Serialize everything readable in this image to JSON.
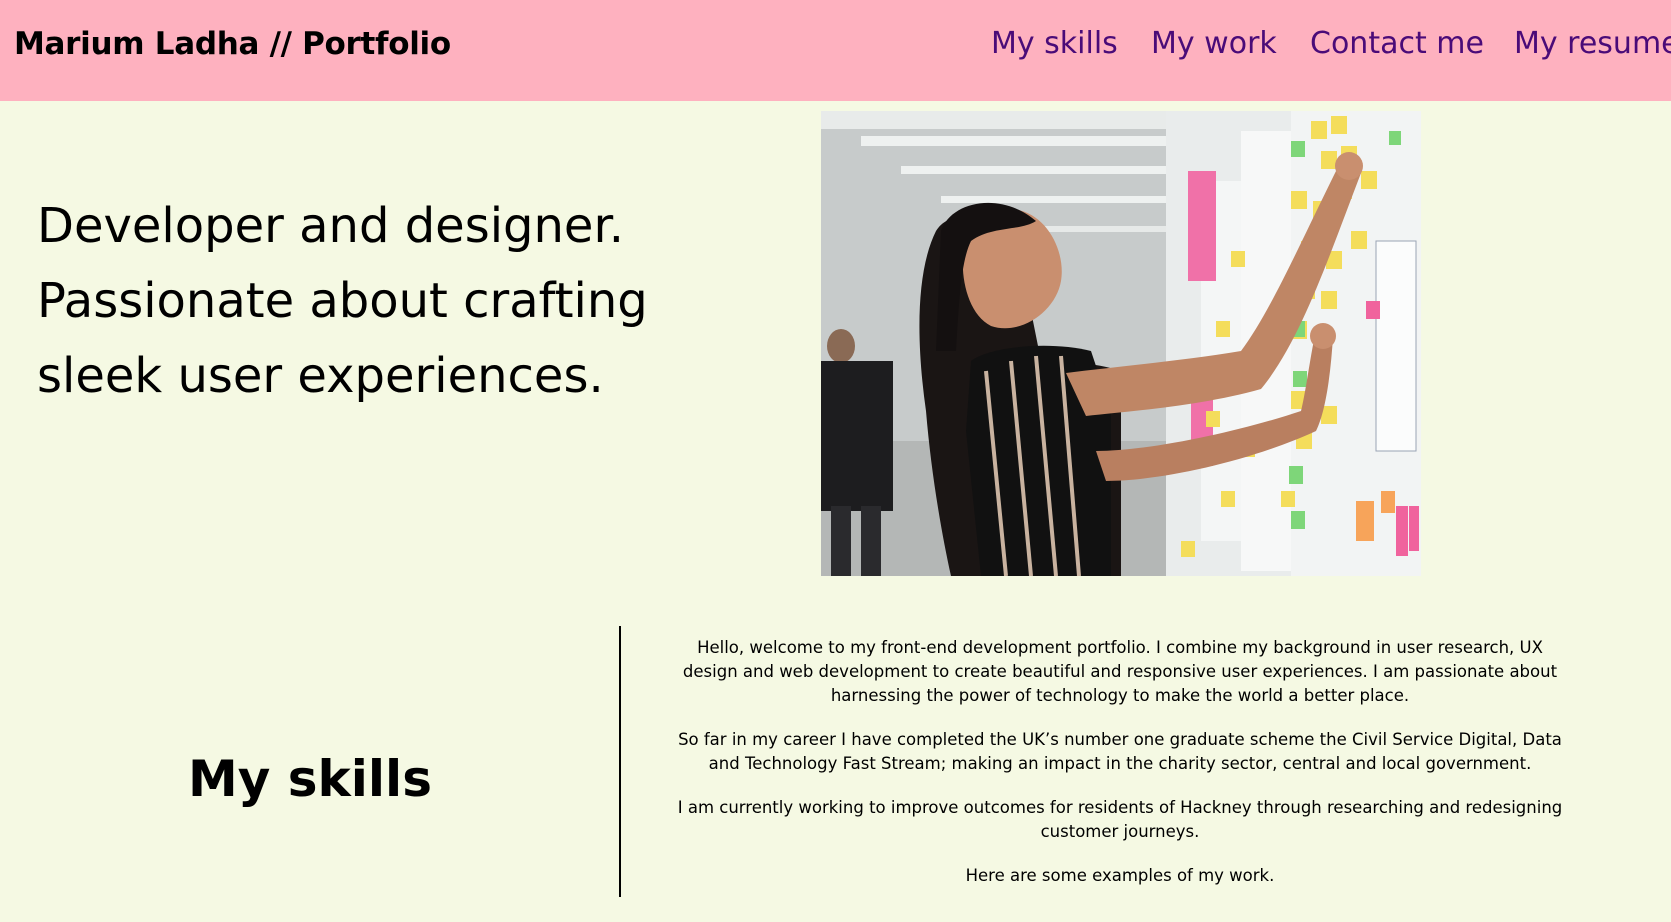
{
  "header": {
    "title": "Marium Ladha // Portfolio",
    "nav": [
      {
        "label": "My skills"
      },
      {
        "label": "My work"
      },
      {
        "label": "Contact me"
      },
      {
        "label": "My resume"
      }
    ]
  },
  "hero": {
    "lines": [
      "Developer and designer.",
      "Passionate about crafting",
      "sleek user experiences."
    ]
  },
  "skills": {
    "heading": "My skills"
  },
  "intro": {
    "paragraphs": [
      "Hello, welcome to my front-end development portfolio. I combine my background in user research, UX design and web development to create beautiful and responsive user experiences. I am passionate about harnessing the power of technology to make the world a better place.",
      "So far in my career I have completed the UK’s number one graduate scheme the Civil Service Digital, Data and Technology Fast Stream; making an impact in the charity sector, central and local government.",
      "I am currently working to improve outcomes for residents of Hackney through researching and redesigning customer journeys.",
      "Here are some examples of my work."
    ]
  },
  "colors": {
    "header_bg": "#feb1bf",
    "page_bg": "#f5f9e3",
    "nav_link": "#4a0b78"
  }
}
